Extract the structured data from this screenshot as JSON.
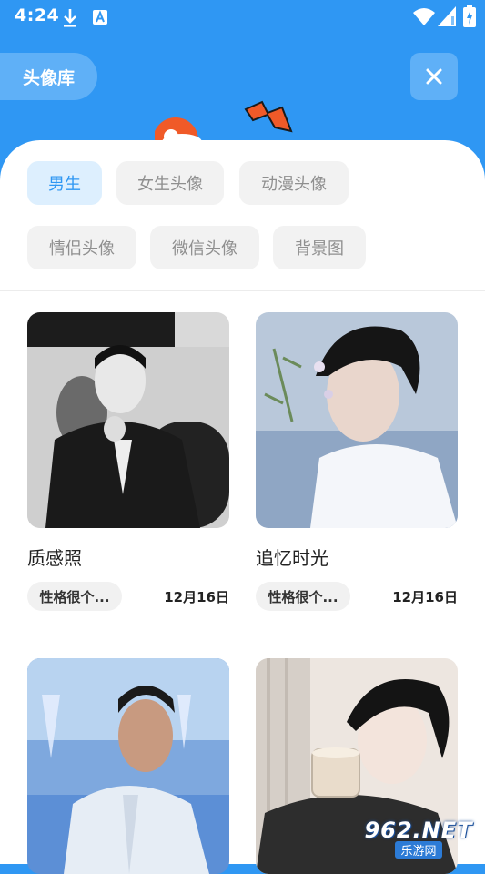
{
  "status_bar": {
    "time": "4:24",
    "icons": [
      "download-icon",
      "app-notification-icon",
      "wifi-icon",
      "signal-icon",
      "battery-charging-icon"
    ]
  },
  "header": {
    "title": "头像库",
    "close_icon": "close-icon"
  },
  "colors": {
    "accent": "#2F97F3",
    "chip_active_bg": "#DDEFFE",
    "chip_bg": "#F2F2F2"
  },
  "categories": [
    {
      "label": "男生",
      "active": true
    },
    {
      "label": "女生头像",
      "active": false
    },
    {
      "label": "动漫头像",
      "active": false
    },
    {
      "label": "情侣头像",
      "active": false
    },
    {
      "label": "微信头像",
      "active": false
    },
    {
      "label": "背景图",
      "active": false
    }
  ],
  "cards": [
    {
      "title": "质感照",
      "tag": "性格很个...",
      "date": "12月16日"
    },
    {
      "title": "追忆时光",
      "tag": "性格很个...",
      "date": "12月16日"
    },
    {
      "title": "",
      "tag": "",
      "date": ""
    },
    {
      "title": "",
      "tag": "",
      "date": ""
    }
  ],
  "watermark": {
    "top": "962.NET",
    "bottom": "乐游网"
  }
}
